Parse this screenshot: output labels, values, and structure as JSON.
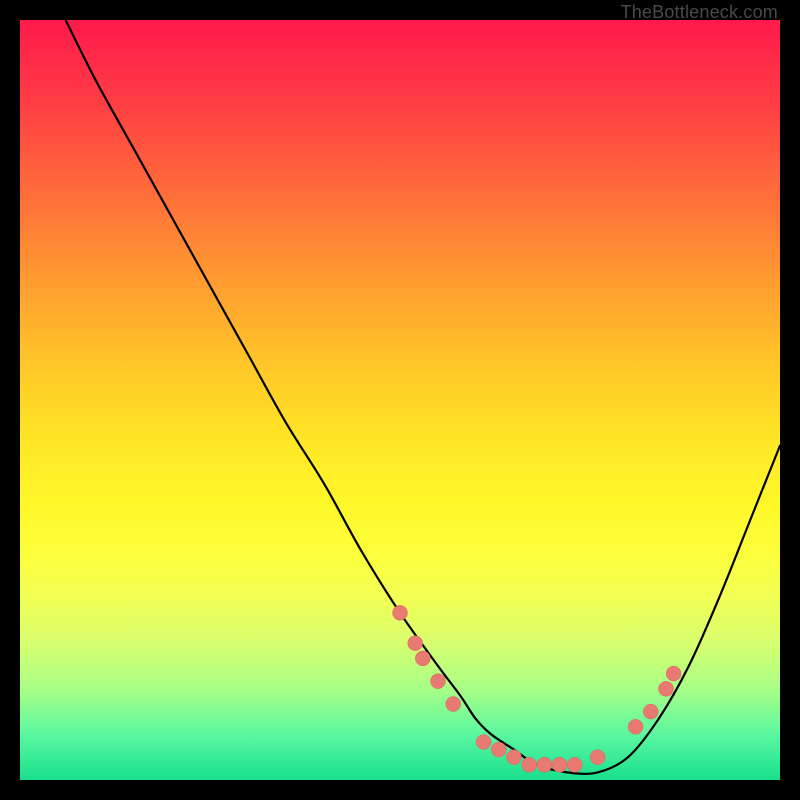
{
  "watermark": "TheBottleneck.com",
  "chart_data": {
    "type": "line",
    "title": "",
    "xlabel": "",
    "ylabel": "",
    "xlim": [
      0,
      100
    ],
    "ylim": [
      0,
      100
    ],
    "grid": false,
    "series": [
      {
        "name": "curve",
        "x": [
          6,
          10,
          15,
          20,
          25,
          30,
          35,
          40,
          45,
          50,
          55,
          58,
          60,
          62,
          65,
          68,
          72,
          76,
          80,
          84,
          88,
          92,
          96,
          100
        ],
        "y": [
          100,
          92,
          83,
          74,
          65,
          56,
          47,
          39,
          30,
          22,
          15,
          11,
          8,
          6,
          4,
          2,
          1,
          1,
          3,
          8,
          15,
          24,
          34,
          44
        ]
      }
    ],
    "points": [
      {
        "x": 50,
        "y": 22
      },
      {
        "x": 52,
        "y": 18
      },
      {
        "x": 53,
        "y": 16
      },
      {
        "x": 55,
        "y": 13
      },
      {
        "x": 57,
        "y": 10
      },
      {
        "x": 61,
        "y": 5
      },
      {
        "x": 63,
        "y": 4
      },
      {
        "x": 65,
        "y": 3
      },
      {
        "x": 67,
        "y": 2
      },
      {
        "x": 69,
        "y": 2
      },
      {
        "x": 71,
        "y": 2
      },
      {
        "x": 73,
        "y": 2
      },
      {
        "x": 76,
        "y": 3
      },
      {
        "x": 81,
        "y": 7
      },
      {
        "x": 83,
        "y": 9
      },
      {
        "x": 85,
        "y": 12
      },
      {
        "x": 86,
        "y": 14
      }
    ]
  }
}
